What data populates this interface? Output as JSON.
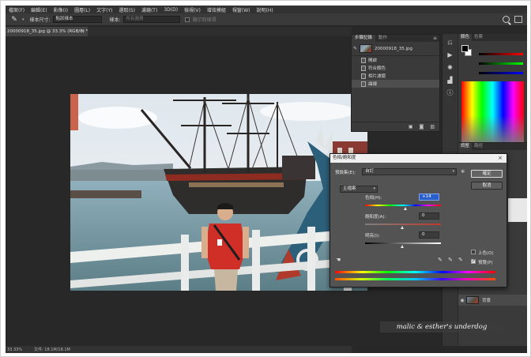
{
  "menu": [
    "檔案(F)",
    "編輯(E)",
    "影像(I)",
    "圖層(L)",
    "文字(Y)",
    "選取(S)",
    "濾鏡(T)",
    "3D(D)",
    "檢視(V)",
    "增效模組",
    "視窗(W)",
    "說明(H)"
  ],
  "options_bar": {
    "sample_label": "樣本尺寸:",
    "sample_value": "點狀樣本",
    "sample2_value": "所有圖層",
    "show_ring_label": "顯示取樣環"
  },
  "document_tab": {
    "title": "20000918_35.jpg @ 33.3% (RGB/8) *"
  },
  "status_bar": {
    "zoom": "33.33%",
    "info": "文件: 18.1M/18.1M"
  },
  "history_panel": {
    "tabs": [
      "步驟記錄",
      "動作"
    ],
    "snapshot": "20000918_35.jpg",
    "steps": [
      "開啟",
      "符合顏色",
      "相片濾鏡",
      "曲線"
    ],
    "current_index": 3
  },
  "color_panel": {
    "tabs": [
      "顏色",
      "色票"
    ]
  },
  "layers_panel": {
    "tabs": [
      "調整",
      "路徑"
    ],
    "layer_name": "背景"
  },
  "dialog": {
    "title": "色相/飽和度",
    "preset_label": "預設集(E):",
    "preset_value": "自訂",
    "channel": "主檔案",
    "ok": "確定",
    "cancel": "取消",
    "hue_label": "色相(H):",
    "hue_value": "+14",
    "hue_norm": 0.539,
    "sat_label": "飽和度(A):",
    "sat_value": "0",
    "light_label": "明亮(I):",
    "light_value": "0",
    "colorize_label": "上色(O)",
    "preview_label": "預覽(P)",
    "colorize": false,
    "preview": true
  },
  "watermark": "malic & esther's underdog",
  "colors": {
    "accent": "#2a5fc9",
    "app_bg": "#282828",
    "panel": "#3a3a3a",
    "dialog": "#535353"
  }
}
